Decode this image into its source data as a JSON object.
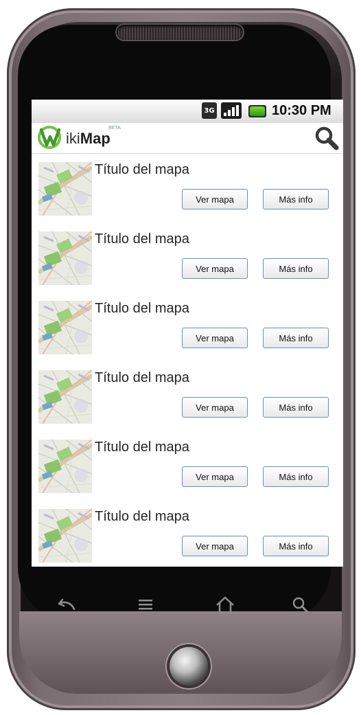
{
  "status_bar": {
    "network": "3G",
    "time": "10:30 PM",
    "battery_color": "#3fbf1a"
  },
  "app_bar": {
    "logo_prefix": "iki",
    "logo_bold": "Map",
    "beta": "BETA",
    "search_icon": "search-icon"
  },
  "maps": [
    {
      "title": "Título del mapa",
      "view_label": "Ver mapa",
      "info_label": "Más info"
    },
    {
      "title": "Título del mapa",
      "view_label": "Ver mapa",
      "info_label": "Más info"
    },
    {
      "title": "Título del mapa",
      "view_label": "Ver mapa",
      "info_label": "Más info"
    },
    {
      "title": "Título del mapa",
      "view_label": "Ver mapa",
      "info_label": "Más info"
    },
    {
      "title": "Título del mapa",
      "view_label": "Ver mapa",
      "info_label": "Más info"
    },
    {
      "title": "Título del mapa",
      "view_label": "Ver mapa",
      "info_label": "Más info"
    }
  ],
  "nav_keys": [
    "back-icon",
    "menu-icon",
    "home-icon",
    "search-icon"
  ]
}
